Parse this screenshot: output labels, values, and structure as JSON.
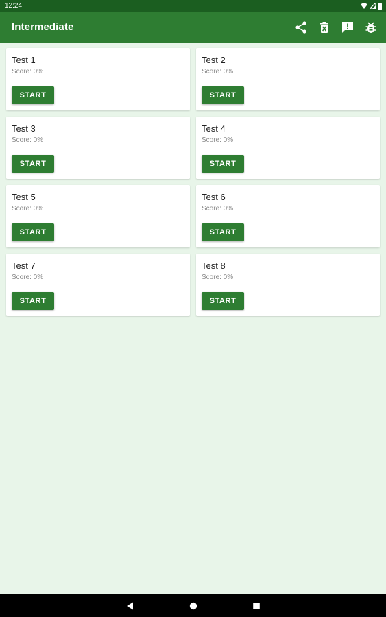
{
  "status_bar": {
    "time": "12:24",
    "icons": [
      "wifi-icon",
      "signal-icon",
      "battery-icon"
    ]
  },
  "app_bar": {
    "title": "Intermediate",
    "actions": [
      "share-icon",
      "delete-icon",
      "feedback-icon",
      "bug-report-icon"
    ]
  },
  "tests": [
    {
      "title": "Test 1",
      "score": "Score: 0%",
      "button": "START"
    },
    {
      "title": "Test 2",
      "score": "Score: 0%",
      "button": "START"
    },
    {
      "title": "Test 3",
      "score": "Score: 0%",
      "button": "START"
    },
    {
      "title": "Test 4",
      "score": "Score: 0%",
      "button": "START"
    },
    {
      "title": "Test 5",
      "score": "Score: 0%",
      "button": "START"
    },
    {
      "title": "Test 6",
      "score": "Score: 0%",
      "button": "START"
    },
    {
      "title": "Test 7",
      "score": "Score: 0%",
      "button": "START"
    },
    {
      "title": "Test 8",
      "score": "Score: 0%",
      "button": "START"
    }
  ],
  "nav_bar": {
    "buttons": [
      "back-icon",
      "home-icon",
      "recents-icon"
    ]
  },
  "colors": {
    "primary": "#2e7d32",
    "primary_dark": "#1b5e20",
    "background": "#e8f5e9"
  }
}
